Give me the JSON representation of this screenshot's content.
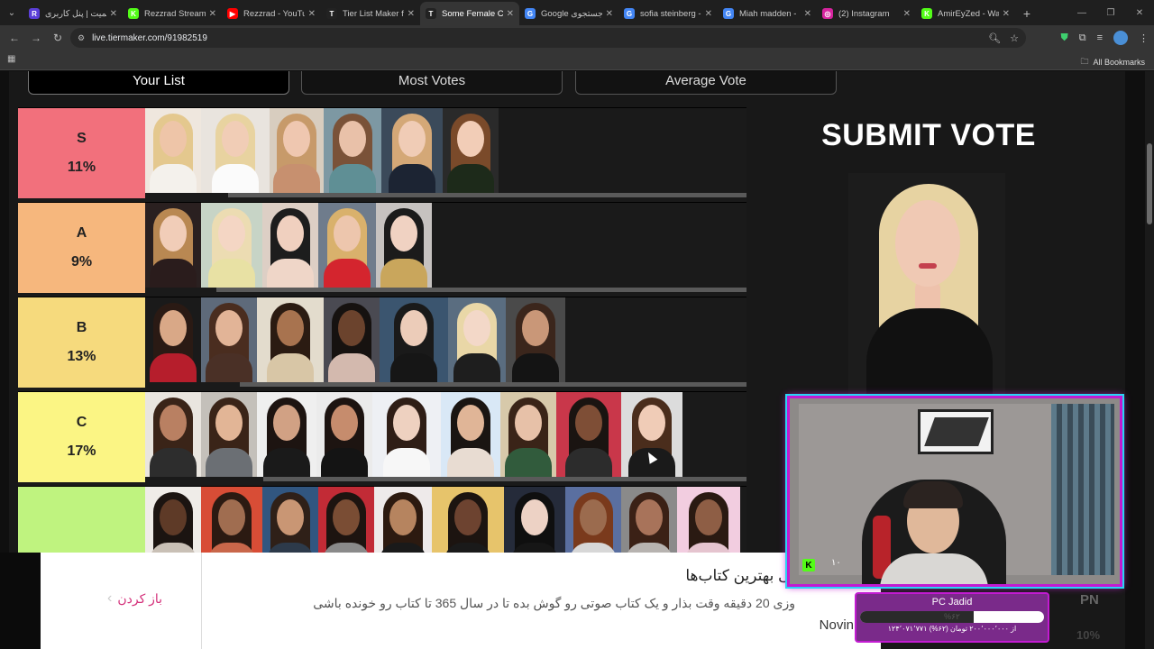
{
  "browser": {
    "tabs": [
      {
        "title": "ریمیت | پنل کاربری",
        "favicon": "R",
        "color": "#5b3fd8"
      },
      {
        "title": "Rezzrad Stream -",
        "favicon": "K",
        "color": "#53fc18"
      },
      {
        "title": "Rezzrad - YouTub",
        "favicon": "▶",
        "color": "#ff0000"
      },
      {
        "title": "Tier List Maker fo",
        "favicon": "T",
        "color": "#222222"
      },
      {
        "title": "Some Female Cele",
        "favicon": "T",
        "color": "#222222",
        "active": true
      },
      {
        "title": "Google جستجوی",
        "favicon": "G",
        "color": "#4285f4"
      },
      {
        "title": "sofia steinberg -",
        "favicon": "G",
        "color": "#4285f4"
      },
      {
        "title": "Miah madden -",
        "favicon": "G",
        "color": "#4285f4"
      },
      {
        "title": "(2) Instagram",
        "favicon": "◎",
        "color": "#d6249f"
      },
      {
        "title": "AmirEyZed - Wat",
        "favicon": "K",
        "color": "#53fc18"
      }
    ],
    "url": "live.tiermaker.com/91982519",
    "bookmarks_label": "All Bookmarks"
  },
  "page": {
    "view_tabs": [
      {
        "label": "Your List",
        "selected": true
      },
      {
        "label": "Most Votes",
        "selected": false
      },
      {
        "label": "Average Vote",
        "selected": false
      }
    ],
    "submit_label": "SUBMIT VOTE",
    "tiers": [
      {
        "name": "S",
        "percent": "11%",
        "color": "#f2707c",
        "vote_fraction": 0.89,
        "images": [
          {
            "skin": "#eec5a8",
            "hair": "#e4c88e",
            "cloth": "#f4f1ec",
            "bg": "#efe7de",
            "w": 62
          },
          {
            "skin": "#f1cdb6",
            "hair": "#e8d3a0",
            "cloth": "#fbfbfb",
            "bg": "#e9e4de",
            "w": 76
          },
          {
            "skin": "#efc7b0",
            "hair": "#c79a6a",
            "cloth": "#c7906f",
            "bg": "#d8cdbf",
            "w": 60
          },
          {
            "skin": "#e9c1a9",
            "hair": "#7a5238",
            "cloth": "#5f8f95",
            "bg": "#7d98a3",
            "w": 64
          },
          {
            "skin": "#f0ccb6",
            "hair": "#d4a877",
            "cloth": "#1c2433",
            "bg": "#3b4a5a",
            "w": 68
          },
          {
            "skin": "#f2cdb7",
            "hair": "#7a4a2a",
            "cloth": "#1d2a1a",
            "bg": "#2a2a2a",
            "w": 62
          }
        ]
      },
      {
        "name": "A",
        "percent": "9%",
        "color": "#f6b77d",
        "vote_fraction": 0.91,
        "images": [
          {
            "skin": "#f1cdb8",
            "hair": "#b98852",
            "cloth": "#2a1c1c",
            "bg": "#2a2020",
            "w": 62
          },
          {
            "skin": "#f4d6c4",
            "hair": "#ecdcb2",
            "cloth": "#e8e1a4",
            "bg": "#c7d4c6",
            "w": 68
          },
          {
            "skin": "#f0d0bf",
            "hair": "#1d1d1d",
            "cloth": "#efd6c8",
            "bg": "#ddcfc5",
            "w": 62
          },
          {
            "skin": "#edc6ad",
            "hair": "#d9b16c",
            "cloth": "#d4252e",
            "bg": "#6f7c8c",
            "w": 64
          },
          {
            "skin": "#f0d2c2",
            "hair": "#1b1b1b",
            "cloth": "#c9a65c",
            "bg": "#c6c2c0",
            "w": 62
          }
        ]
      },
      {
        "name": "B",
        "percent": "13%",
        "color": "#f6da7d",
        "vote_fraction": 0.87,
        "images": [
          {
            "skin": "#d9a887",
            "hair": "#2a1a14",
            "cloth": "#b61e2c",
            "bg": "#1a1a1a",
            "w": 62
          },
          {
            "skin": "#e2b497",
            "hair": "#4a2d1f",
            "cloth": "#4a3026",
            "bg": "#5e6a7a",
            "w": 62
          },
          {
            "skin": "#a8734f",
            "hair": "#2b1b12",
            "cloth": "#d8c6a6",
            "bg": "#e3dccd",
            "w": 74
          },
          {
            "skin": "#6b432d",
            "hair": "#161210",
            "cloth": "#d3b9ae",
            "bg": "#4a4a52",
            "w": 62
          },
          {
            "skin": "#ecccb9",
            "hair": "#1a1a1a",
            "cloth": "#161616",
            "bg": "#3b556f",
            "w": 76
          },
          {
            "skin": "#f3d8c8",
            "hair": "#e9d7a7",
            "cloth": "#1e1e1e",
            "bg": "#5a6d80",
            "w": 64
          },
          {
            "skin": "#c99778",
            "hair": "#3b261c",
            "cloth": "#141414",
            "bg": "#4a4a4a",
            "w": 66
          }
        ]
      },
      {
        "name": "C",
        "percent": "17%",
        "color": "#fbf584",
        "vote_fraction": 0.83,
        "images": [
          {
            "skin": "#b98062",
            "hair": "#3a2418",
            "cloth": "#2d2d2d",
            "bg": "#e9e5df",
            "w": 62
          },
          {
            "skin": "#e2b596",
            "hair": "#3a2418",
            "cloth": "#6b6f74",
            "bg": "#c4c0ba",
            "w": 62
          },
          {
            "skin": "#d1a184",
            "hair": "#1d1411",
            "cloth": "#1a1a1a",
            "bg": "#efefef",
            "w": 66
          },
          {
            "skin": "#c68c6d",
            "hair": "#1d1411",
            "cloth": "#141414",
            "bg": "#ebebeb",
            "w": 62
          },
          {
            "skin": "#eed1c0",
            "hair": "#2f1e16",
            "cloth": "#f7f7f7",
            "bg": "#eef0f4",
            "w": 76
          },
          {
            "skin": "#e0b597",
            "hair": "#1a1512",
            "cloth": "#e8dcd2",
            "bg": "#d9e8f6",
            "w": 66
          },
          {
            "skin": "#e7c1a8",
            "hair": "#3a2418",
            "cloth": "#315b3c",
            "bg": "#d7c9aa",
            "w": 62
          },
          {
            "skin": "#7e4e36",
            "hair": "#1a1411",
            "cloth": "#2c2c2c",
            "bg": "#c9374a",
            "w": 72
          },
          {
            "skin": "#f0ccb7",
            "hair": "#4a2d1c",
            "cloth": "#1a1a1a",
            "bg": "#dcdcdc",
            "w": 68
          }
        ]
      },
      {
        "name": "",
        "percent": "",
        "color": "#bff37f",
        "vote_fraction": 0.0,
        "images": [
          {
            "skin": "#5e3a27",
            "hair": "#1b1411",
            "cloth": "#c9c0b6",
            "bg": "#efece8",
            "w": 62
          },
          {
            "skin": "#a06d50",
            "hair": "#2b1a12",
            "cloth": "#c9674a",
            "bg": "#d84d36",
            "w": 68
          },
          {
            "skin": "#c99674",
            "hair": "#2f2018",
            "cloth": "#2d3a4a",
            "bg": "#315680",
            "w": 62
          },
          {
            "skin": "#7a4d34",
            "hair": "#1d1410",
            "cloth": "#8a8a8a",
            "bg": "#c22b36",
            "w": 62
          },
          {
            "skin": "#b6845f",
            "hair": "#2c1a10",
            "cloth": "#1a1a1a",
            "bg": "#eeeaea",
            "w": 64
          },
          {
            "skin": "#6d4330",
            "hair": "#1c1410",
            "cloth": "#1a1a1a",
            "bg": "#e7c46b",
            "w": 80
          },
          {
            "skin": "#edd2c5",
            "hair": "#0f0f0f",
            "cloth": "#161616",
            "bg": "#252b3a",
            "w": 68
          },
          {
            "skin": "#9b6b4e",
            "hair": "#7a3a1c",
            "cloth": "#d7d7d7",
            "bg": "#5a6fa0",
            "w": 62
          },
          {
            "skin": "#a8735a",
            "hair": "#3b2116",
            "cloth": "#b7b3b0",
            "bg": "#8a8a8a",
            "w": 62
          },
          {
            "skin": "#8e5e45",
            "hair": "#2a1a12",
            "cloth": "#e5c4cf",
            "bg": "#f2cde0",
            "w": 70
          }
        ]
      }
    ]
  },
  "webcam": {
    "overlay_number": "۱۰"
  },
  "donation": {
    "name": "PC Jadid",
    "percent_label": "%۶۲",
    "progress": 0.62,
    "subtitle": "۱۲۴٬۰۷۱٬۷۷۱ از ۲۰۰٬۰۰۰٬۰۰۰ تومان (۶۲%)",
    "badge": "PN",
    "badge_sub": "10%"
  },
  "ad": {
    "back_label": "باز کردن",
    "title": "تی بهترین کتاب‌ها",
    "text": "وزی 20 دقیقه وقت بذار و یک کتاب صوتی رو گوش بده تا در سال 365 تا کتاب رو خونده باشی",
    "brand": "Novin"
  }
}
